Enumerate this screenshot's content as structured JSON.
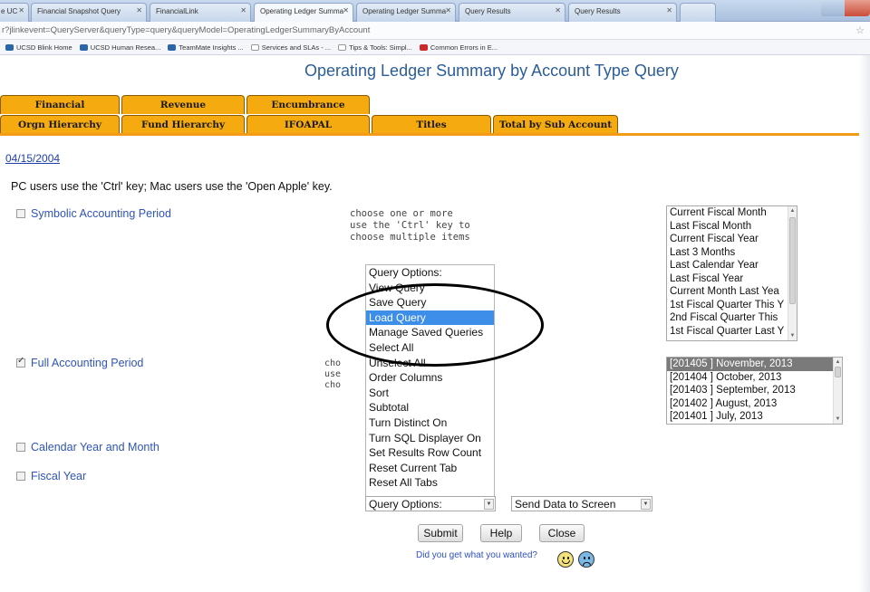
{
  "browser": {
    "tabs": [
      {
        "label": "e UC",
        "active": false
      },
      {
        "label": "Financial Snapshot Query",
        "active": false
      },
      {
        "label": "FinancialLink",
        "active": false
      },
      {
        "label": "Operating Ledger Summa",
        "active": true
      },
      {
        "label": "Operating Ledger Summa",
        "active": false
      },
      {
        "label": "Query Results",
        "active": false
      },
      {
        "label": "Query Results",
        "active": false
      }
    ],
    "address": "r?jlinkevent=QueryServer&queryType=query&queryModel=OperatingLedgerSummaryByAccount",
    "bookmarks": [
      "UCSD Blink Home",
      "UCSD Human Resea...",
      "TeamMate Insights ...",
      "Services and SLAs - ...",
      "Tips & Tools: Simpl...",
      "Common Errors in E..."
    ]
  },
  "page": {
    "title": "Operating Ledger Summary by Account Type Query",
    "tabs_row1": [
      "Financial",
      "Revenue",
      "Encumbrance"
    ],
    "tabs_row2": [
      "Orgn Hierarchy",
      "Fund Hierarchy",
      "IFOAPAL",
      "Titles",
      "Total by Sub Account"
    ],
    "date_link": "04/15/2004",
    "hint": "PC users use the 'Ctrl' key; Mac users use the 'Open Apple' key.",
    "symbolic": {
      "label": "Symbolic Accounting Period",
      "checked": false
    },
    "full": {
      "label": "Full Accounting Period",
      "checked": true
    },
    "calendar": {
      "label": "Calendar Year and Month",
      "checked": false
    },
    "fiscal": {
      "label": "Fiscal Year",
      "checked": false
    },
    "choose_hint": "choose one or more\nuse the 'Ctrl' key to\nchoose multiple items",
    "choose_hint_partial": "cho\nuse\ncho",
    "symbolic_options": [
      "Current Fiscal Month",
      "Last Fiscal Month",
      "Current Fiscal Year",
      "Last 3 Months",
      "Last Calendar Year",
      "Last Fiscal Year",
      "Current Month Last Yea",
      "1st Fiscal Quarter This Y",
      "2nd Fiscal Quarter This",
      "1st Fiscal Quarter Last Y"
    ],
    "full_options": [
      "[201405 ] November, 2013",
      "[201404 ] October, 2013",
      "[201403 ] September, 2013",
      "[201402 ] August, 2013",
      "[201401 ] July, 2013"
    ],
    "query_options": [
      "Query Options:",
      "View Query",
      "Save Query",
      "Load Query",
      "Manage Saved Queries",
      "Select All",
      "Unselect All",
      "Order Columns",
      "Sort",
      "Subtotal",
      "Turn Distinct On",
      "Turn SQL Displayer On",
      "Set Results Row Count",
      "Reset Current Tab",
      "Reset All Tabs"
    ],
    "highlighted_option": "Load Query",
    "query_select_value": "Query Options:",
    "send_select_value": "Send Data to Screen",
    "buttons": {
      "submit": "Submit",
      "help": "Help",
      "close": "Close"
    },
    "feedback": "Did you get what you wanted?"
  },
  "colors": {
    "accent_tab": "#f5aa0f",
    "title": "#2a5d9a",
    "highlight": "#3d8ee8"
  }
}
